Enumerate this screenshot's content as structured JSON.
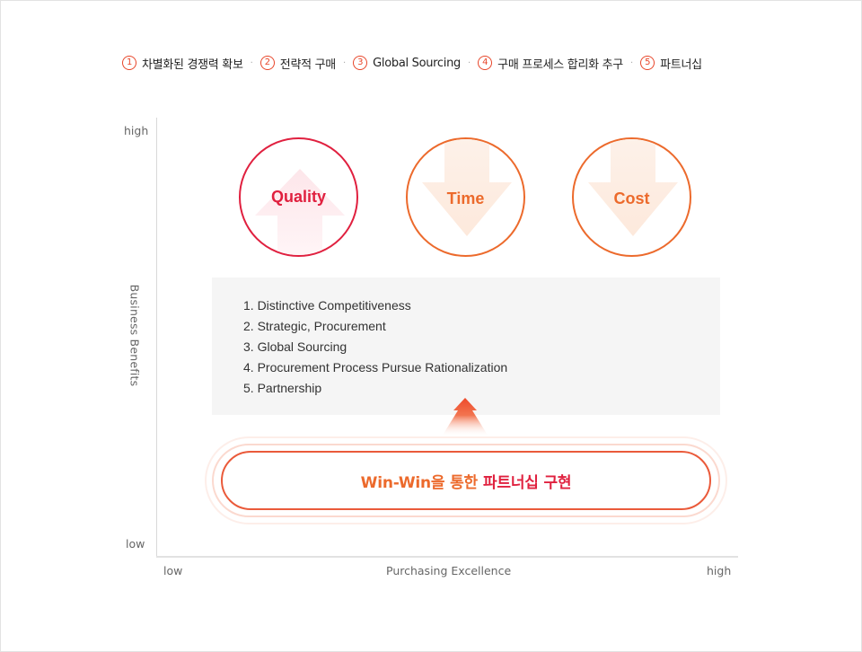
{
  "legend": {
    "items": [
      {
        "num": "1",
        "label": "차별화된 경쟁력 확보"
      },
      {
        "num": "2",
        "label": "전략적 구매"
      },
      {
        "num": "3",
        "label": "Global Sourcing"
      },
      {
        "num": "4",
        "label": "구매 프로세스 합리화 추구"
      },
      {
        "num": "5",
        "label": "파트너십"
      }
    ],
    "separator": "·"
  },
  "axes": {
    "y_title": "Business Benefits",
    "y_high": "high",
    "y_low": "low",
    "x_title": "Purchasing Excellence",
    "x_low": "low",
    "x_high": "high"
  },
  "circles": [
    {
      "label": "Quality",
      "direction": "up",
      "color": "#e0203f",
      "arrow_color": "#fde6ea"
    },
    {
      "label": "Time",
      "direction": "down",
      "color": "#ec6a2c",
      "arrow_color": "#fde9dc"
    },
    {
      "label": "Cost",
      "direction": "down",
      "color": "#ec6a2c",
      "arrow_color": "#fde9dc"
    }
  ],
  "info_list": [
    "1. Distinctive Competitiveness",
    "2. Strategic, Procurement",
    "3. Global Sourcing",
    "4. Procurement Process Pursue Rationalization",
    "5. Partnership"
  ],
  "goal": {
    "part1": "Win-Win을 통한",
    "part2": "파트너십 구현"
  },
  "colors": {
    "accent_red": "#e0203f",
    "accent_orange": "#ec6a2c",
    "arrow_red": "#ee4a2b"
  }
}
